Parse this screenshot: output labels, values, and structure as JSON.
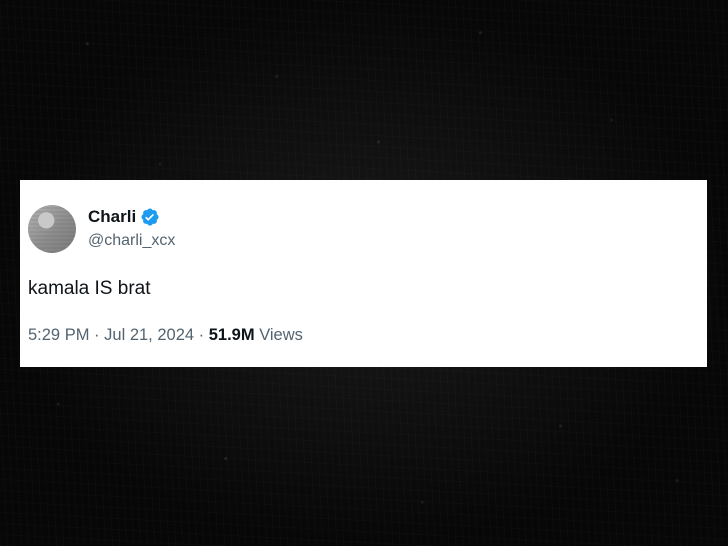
{
  "tweet": {
    "display_name": "Charli",
    "handle": "@charli_xcx",
    "verified": true,
    "verified_icon": "verified-badge-icon",
    "text": "kamala IS brat",
    "time": "5:29 PM",
    "separator": "·",
    "date": "Jul 21, 2024",
    "views_count": "51.9M",
    "views_label": "Views"
  },
  "colors": {
    "background": "#070707",
    "card": "#ffffff",
    "primary_text": "#0f1419",
    "secondary_text": "#536471",
    "verified_blue": "#1d9bf0"
  }
}
